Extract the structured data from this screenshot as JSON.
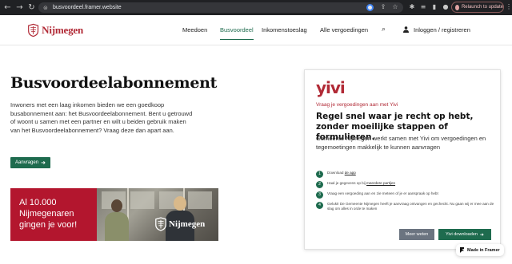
{
  "browser": {
    "url": "busvoordeel.framer.website",
    "relaunch_label": "Relaunch to update",
    "nav_icons": [
      "back-icon",
      "forward-icon",
      "reload-icon"
    ]
  },
  "header": {
    "logo_text": "Nijmegen",
    "nav": [
      "Meedoen",
      "Busvoordeel",
      "Inkomenstoeslag",
      "Alle vergoedingen"
    ],
    "active_nav": "Busvoordeel",
    "login_label": "Inloggen / registreren"
  },
  "hero": {
    "title": "Busvoordeelabonnement",
    "text": "Inwoners met een laag inkomen bieden we een goedkoop busabonnement aan: het Busvoordeelabonnement. Bent u getrouwd of woont u samen met een partner en wilt u beiden gebruik maken van het Busvoordeelabonnement? Vraag deze dan apart aan.",
    "button_label": "Aanvragen"
  },
  "banner": {
    "lines": [
      "Al 10.000",
      "Nijmegenaren",
      "gingen je voor!"
    ],
    "photo_logo_text": "Nijmegen"
  },
  "card": {
    "logo_text": "yivi",
    "subtitle": "Vraag je vergoedingen aan met Yivi",
    "title": "Regel snel waar je recht op hebt, zonder moeilijke stappen of formulieren.",
    "text": "Gemeente Nijmegen werkt samen met Yivi om vergoedingen en tegemoetingen makkelijk te kunnen aanvragen",
    "steps": [
      {
        "num": "1",
        "before": "Download ",
        "link": "de app",
        "after": ""
      },
      {
        "num": "2",
        "before": "Haal je gegevens op bij ",
        "link": "meerdere partijen",
        "after": ""
      },
      {
        "num": "3",
        "before": "Vraag een vergoeding aan en zie meteen of je er aanspraak op hebt",
        "link": "",
        "after": ""
      },
      {
        "num": "4",
        "before": "Gelukt! De Gemeente Nijmegen heeft je aanvraag ontvangen en gecheckt. Nu gaan wij er mee aan de slag om alles in orde te maken",
        "link": "",
        "after": ""
      }
    ],
    "more_label": "Meer weten",
    "download_label": "Yivi downloaden"
  },
  "framer_badge": "Made in Framer",
  "colors": {
    "brand_red": "#b12a36",
    "brand_green": "#1e6b4e",
    "banner_red": "#b3162e"
  }
}
